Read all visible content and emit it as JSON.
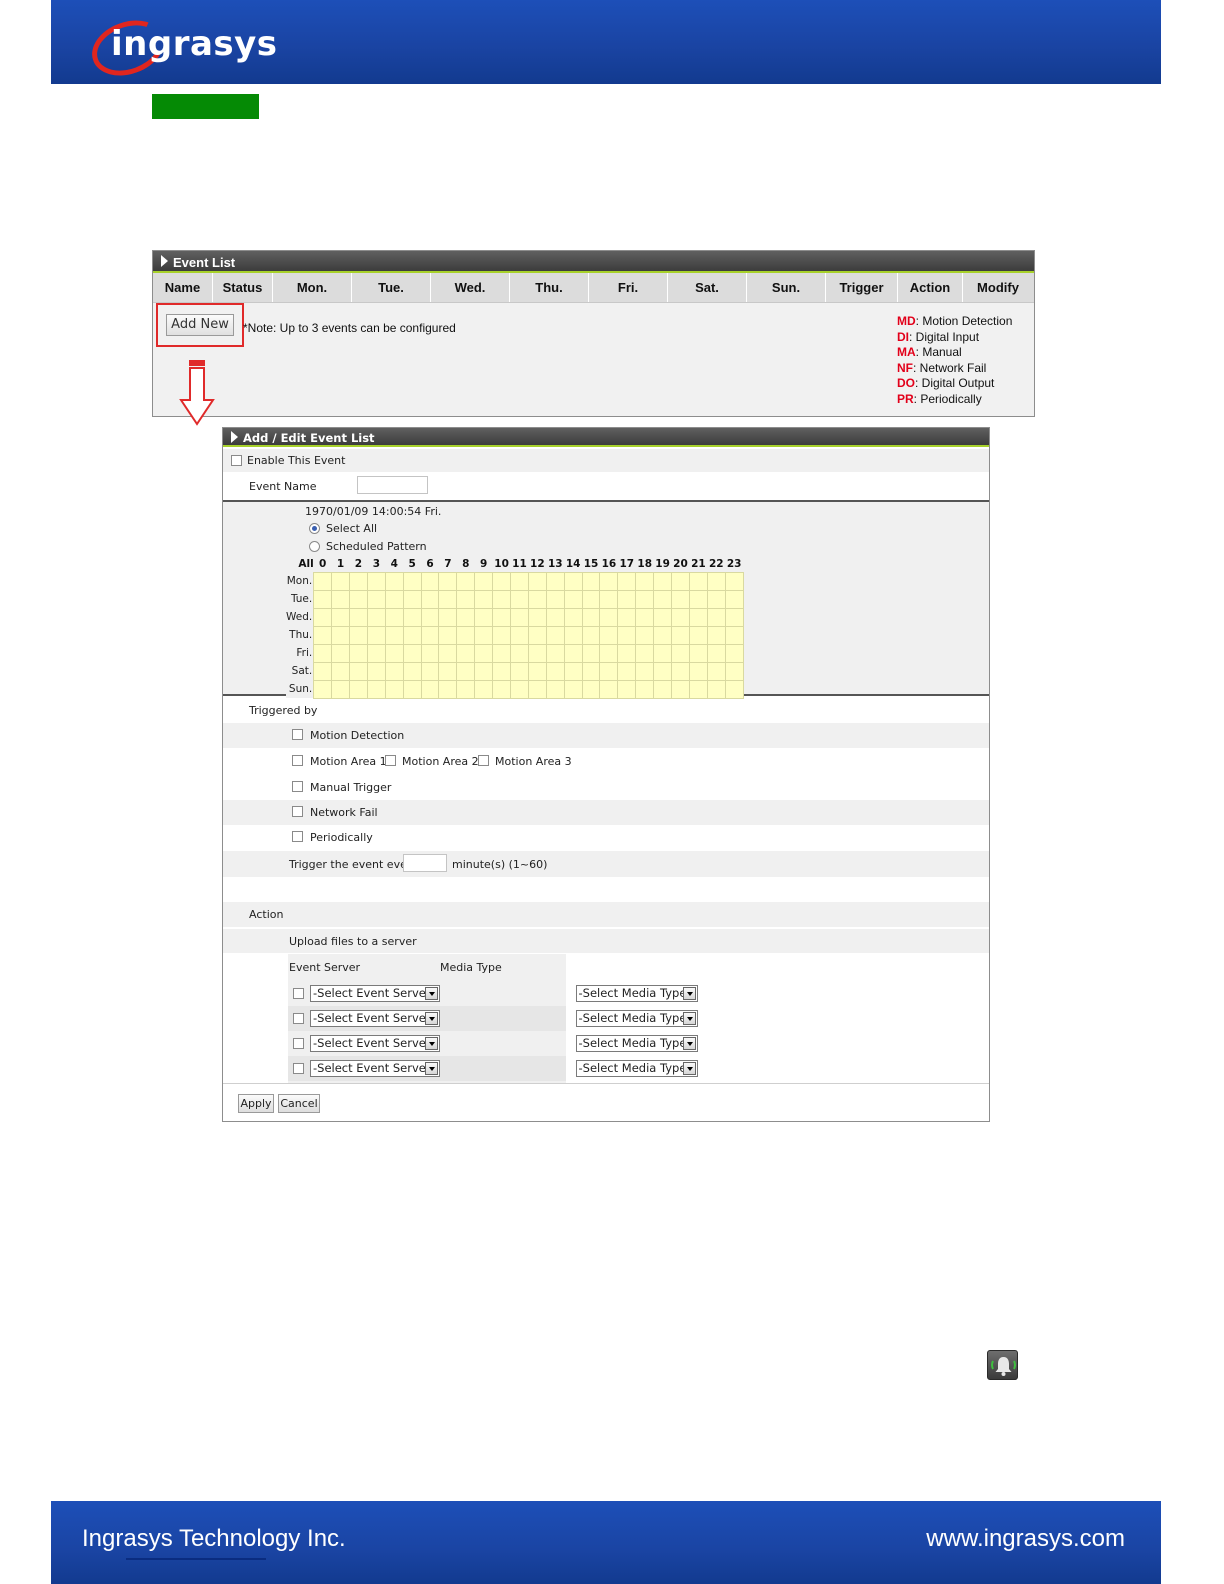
{
  "header": {
    "logo_text": "ingrasys",
    "brand_color": "#1a44a3"
  },
  "event_list": {
    "title": "Event List",
    "columns": [
      "Name",
      "Status",
      "Mon.",
      "Tue.",
      "Wed.",
      "Thu.",
      "Fri.",
      "Sat.",
      "Sun.",
      "Trigger",
      "Action",
      "Modify"
    ],
    "add_new_label": "Add New",
    "note": "*Note: Up to 3 events can be configured",
    "legend": [
      {
        "code": "MD",
        "text": ": Motion Detection"
      },
      {
        "code": "DI",
        "text": ": Digital Input"
      },
      {
        "code": "MA",
        "text": ": Manual"
      },
      {
        "code": "NF",
        "text": ": Network Fail"
      },
      {
        "code": "DO",
        "text": ": Digital Output"
      },
      {
        "code": "PR",
        "text": ": Periodically"
      }
    ]
  },
  "edit_panel": {
    "title": "Add / Edit Event List",
    "enable_label": "Enable This Event",
    "event_name_label": "Event Name",
    "event_name_value": "",
    "datetime": "1970/01/09 14:00:54 Fri.",
    "select_all_label": "Select All",
    "scheduled_label": "Scheduled Pattern",
    "grid_all_label": "All",
    "hours": [
      "0",
      "1",
      "2",
      "3",
      "4",
      "5",
      "6",
      "7",
      "8",
      "9",
      "10",
      "11",
      "12",
      "13",
      "14",
      "15",
      "16",
      "17",
      "18",
      "19",
      "20",
      "21",
      "22",
      "23"
    ],
    "days": [
      "Mon.",
      "Tue.",
      "Wed.",
      "Thu.",
      "Fri.",
      "Sat.",
      "Sun."
    ],
    "triggered_by_label": "Triggered by",
    "motion_detection_label": "Motion Detection",
    "motion_area_1": "Motion Area 1",
    "motion_area_2": "Motion Area 2",
    "motion_area_3": "Motion Area 3",
    "manual_trigger_label": "Manual Trigger",
    "network_fail_label": "Network Fail",
    "periodically_label": "Periodically",
    "trigger_every_label": "Trigger the event every",
    "trigger_every_value": "",
    "minutes_label": "minute(s) (1~60)",
    "action_label": "Action",
    "upload_label": "Upload files to a server",
    "event_server_header": "Event Server",
    "media_type_header": "Media Type",
    "server_placeholder": "-Select Event Server-",
    "media_placeholder": "-Select Media Type-",
    "apply_label": "Apply",
    "cancel_label": "Cancel"
  },
  "footer": {
    "company": "Ingrasys Technology Inc.",
    "url": "www.ingrasys.com"
  },
  "colors": {
    "legend_code": "#e2001a",
    "highlight_border": "#e02a2a",
    "grid_cell": "#ffffc4",
    "green_tag": "#058a05"
  }
}
